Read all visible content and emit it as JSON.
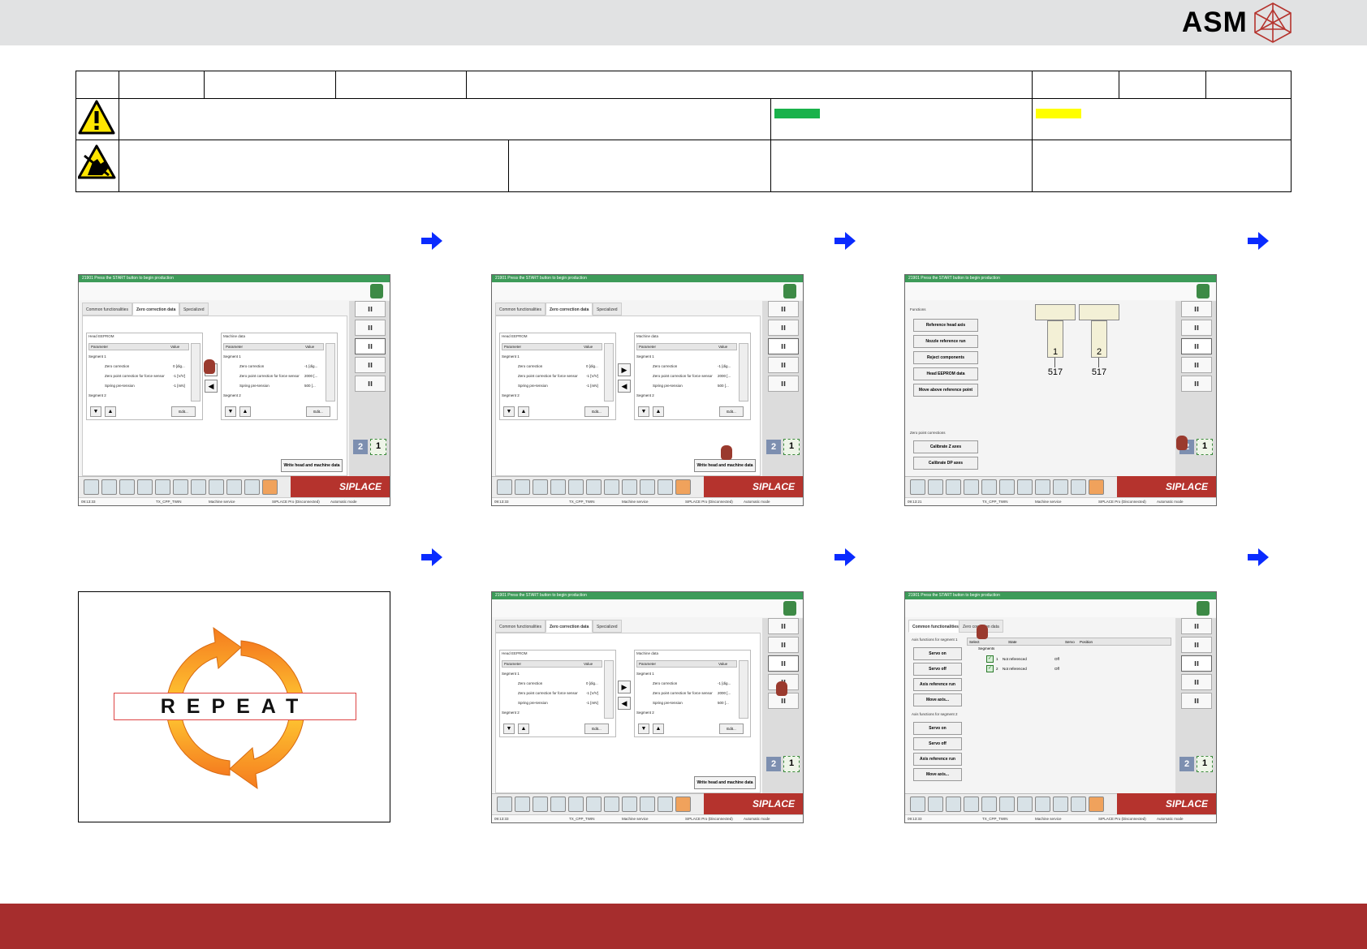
{
  "header": {
    "logo_text": "ASM"
  },
  "status_colors": {
    "green": "#19b24b",
    "yellow": "#ffff00",
    "footer": "#a62d2d",
    "arrow": "#0a2bff"
  },
  "icons": {
    "warning": "warning-triangle-icon",
    "esd": "esd-hand-icon",
    "arrow": "arrow-right-icon"
  },
  "screens": {
    "title_bar": "21901 Press the START button to begin production",
    "brand": "SIPLACE",
    "station": "TX_CPP_TWIN",
    "mode_service": "Machine service",
    "connection": "SIPLACE Pro (Disconnected)",
    "auto_mode": "Automatic mode",
    "time_a": "09:13:33",
    "time_b": "09:13:21",
    "tab_common": "Common functionalities",
    "tab_zero": "Zero correction data",
    "tab_special": "Specialized",
    "head_eeprom": "Head EEPROM",
    "machine_data": "Machine data",
    "col_parameter": "Parameter",
    "col_value": "Value",
    "segment1": "Segment 1",
    "segment2": "Segment 2",
    "zero_correction": "Zero correction",
    "zero_point_force": "Zero point correction for force sensor",
    "spring": "Spring pre-tension",
    "v_zero_a": "0 [dig...",
    "v_zero_b": "-1 [V/V]",
    "v_spring_a": "-1 [mN]",
    "v_zero_m": "-1 [dig...",
    "v_zero_point_m": "2000 [...",
    "v_spring_m": "500 [...",
    "edit": "Edit...",
    "write_btn": "Write head and machine data",
    "n2": "2",
    "n1": "1",
    "functions": "Functions",
    "ref_head_axis": "Reference head axis",
    "nozzle_ref": "Nozzle reference run",
    "reject": "Reject components",
    "head_eeprom_data": "Head EEPROM data",
    "move_above": "Move above reference point",
    "zero_point_corr": "Zero point corrections",
    "calib_z": "Calibrate Z axes",
    "calib_dp": "Calibrate DP axes",
    "nozzle1_num": "1",
    "nozzle2_num": "2",
    "nozzle1_val": "517",
    "nozzle2_val": "517",
    "axis_seg1": "Axis functions for segment 1",
    "axis_seg2": "Axis functions for segment 2",
    "servo_on": "Servo on",
    "servo_off": "Servo off",
    "axis_ref": "Axis reference run",
    "move_axis": "Move axis...",
    "col_select": "Select",
    "col_state": "State",
    "col_servo": "Servo",
    "col_position": "Position",
    "segments": "Segments",
    "row1_num": "1",
    "row2_num": "2",
    "not_referenced": "Not referenced",
    "off": "Off"
  },
  "repeat": {
    "label": "REPEAT"
  }
}
